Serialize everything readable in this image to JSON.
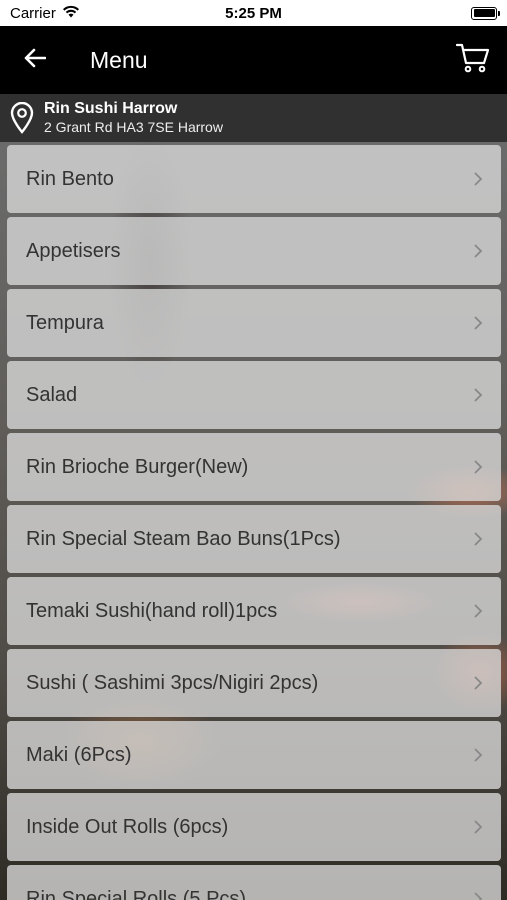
{
  "status_bar": {
    "carrier": "Carrier",
    "time": "5:25 PM"
  },
  "nav": {
    "title": "Menu"
  },
  "location": {
    "name": "Rin Sushi Harrow",
    "address": "2 Grant Rd HA3 7SE Harrow"
  },
  "menu": {
    "items": [
      {
        "label": "Rin Bento"
      },
      {
        "label": "Appetisers"
      },
      {
        "label": "Tempura"
      },
      {
        "label": "Salad"
      },
      {
        "label": "Rin Brioche Burger(New)"
      },
      {
        "label": "Rin Special Steam Bao Buns(1Pcs)"
      },
      {
        "label": "Temaki Sushi(hand roll)1pcs"
      },
      {
        "label": "Sushi ( Sashimi 3pcs/Nigiri 2pcs)"
      },
      {
        "label": "Maki (6Pcs)"
      },
      {
        "label": "Inside Out Rolls (6pcs)"
      },
      {
        "label": "Rin Special Rolls (5 Pcs)"
      }
    ]
  },
  "icons": {
    "wifi": "wifi-icon",
    "battery": "battery-icon",
    "back": "arrow-left-icon",
    "cart": "cart-icon",
    "location": "map-pin-icon",
    "chevron": "chevron-right-icon"
  },
  "colors": {
    "nav_bg": "#000000",
    "location_bg": "#1e1e1e",
    "item_bg": "#d7d7d7",
    "item_text": "#333333"
  }
}
